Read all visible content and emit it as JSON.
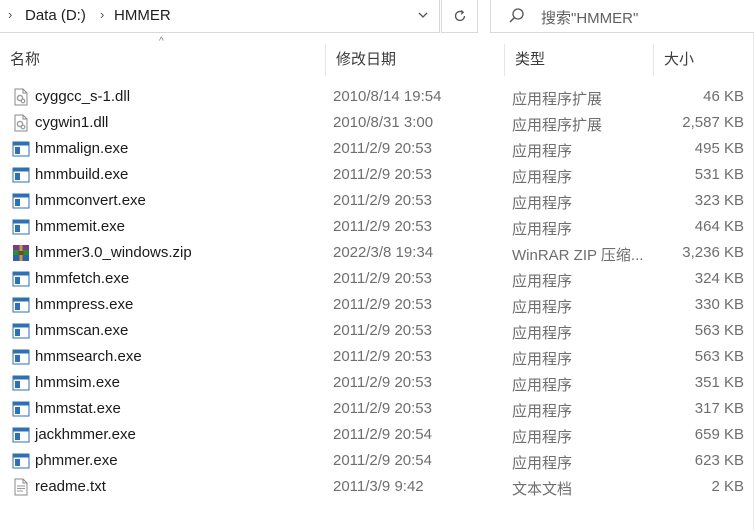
{
  "address": {
    "drive": "Data (D:)",
    "folder": "HMMER"
  },
  "search": {
    "placeholder": "搜索\"HMMER\""
  },
  "columns": {
    "name": "名称",
    "date": "修改日期",
    "type": "类型",
    "size": "大小"
  },
  "files": [
    {
      "name": "cyggcc_s-1.dll",
      "date": "2010/8/14 19:54",
      "type": "应用程序扩展",
      "size": "46 KB",
      "icon": "dll-icon"
    },
    {
      "name": "cygwin1.dll",
      "date": "2010/8/31 3:00",
      "type": "应用程序扩展",
      "size": "2,587 KB",
      "icon": "dll-icon"
    },
    {
      "name": "hmmalign.exe",
      "date": "2011/2/9 20:53",
      "type": "应用程序",
      "size": "495 KB",
      "icon": "exe-icon"
    },
    {
      "name": "hmmbuild.exe",
      "date": "2011/2/9 20:53",
      "type": "应用程序",
      "size": "531 KB",
      "icon": "exe-icon"
    },
    {
      "name": "hmmconvert.exe",
      "date": "2011/2/9 20:53",
      "type": "应用程序",
      "size": "323 KB",
      "icon": "exe-icon"
    },
    {
      "name": "hmmemit.exe",
      "date": "2011/2/9 20:53",
      "type": "应用程序",
      "size": "464 KB",
      "icon": "exe-icon"
    },
    {
      "name": "hmmer3.0_windows.zip",
      "date": "2022/3/8 19:34",
      "type": "WinRAR ZIP 压缩...",
      "size": "3,236 KB",
      "icon": "winrar-icon"
    },
    {
      "name": "hmmfetch.exe",
      "date": "2011/2/9 20:53",
      "type": "应用程序",
      "size": "324 KB",
      "icon": "exe-icon"
    },
    {
      "name": "hmmpress.exe",
      "date": "2011/2/9 20:53",
      "type": "应用程序",
      "size": "330 KB",
      "icon": "exe-icon"
    },
    {
      "name": "hmmscan.exe",
      "date": "2011/2/9 20:53",
      "type": "应用程序",
      "size": "563 KB",
      "icon": "exe-icon"
    },
    {
      "name": "hmmsearch.exe",
      "date": "2011/2/9 20:53",
      "type": "应用程序",
      "size": "563 KB",
      "icon": "exe-icon"
    },
    {
      "name": "hmmsim.exe",
      "date": "2011/2/9 20:53",
      "type": "应用程序",
      "size": "351 KB",
      "icon": "exe-icon"
    },
    {
      "name": "hmmstat.exe",
      "date": "2011/2/9 20:53",
      "type": "应用程序",
      "size": "317 KB",
      "icon": "exe-icon"
    },
    {
      "name": "jackhmmer.exe",
      "date": "2011/2/9 20:54",
      "type": "应用程序",
      "size": "659 KB",
      "icon": "exe-icon"
    },
    {
      "name": "phmmer.exe",
      "date": "2011/2/9 20:54",
      "type": "应用程序",
      "size": "623 KB",
      "icon": "exe-icon"
    },
    {
      "name": "readme.txt",
      "date": "2011/3/9 9:42",
      "type": "文本文档",
      "size": "2 KB",
      "icon": "txt-icon"
    }
  ]
}
